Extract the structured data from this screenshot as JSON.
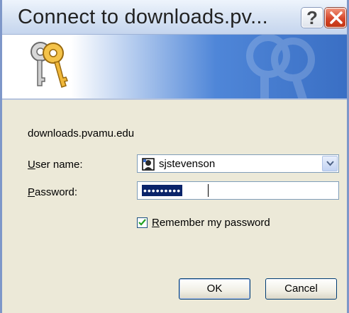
{
  "window": {
    "title": "Connect to downloads.pv...",
    "help_glyph": "?",
    "close_icon": "close-icon"
  },
  "banner": {
    "icon": "keys-icon",
    "gradient_colors": [
      "#ffffff",
      "#3a6fc4"
    ]
  },
  "server": "downloads.pvamu.edu",
  "fields": {
    "user": {
      "label_first": "U",
      "label_rest": "ser name:",
      "value": "sjstevenson",
      "icon": "user-icon"
    },
    "password": {
      "label_first": "P",
      "label_rest": "assword:",
      "masked": "•••••••••"
    }
  },
  "remember": {
    "label_first": "R",
    "label_rest": "emember my password",
    "checked": true
  },
  "buttons": {
    "ok": "OK",
    "cancel": "Cancel"
  }
}
